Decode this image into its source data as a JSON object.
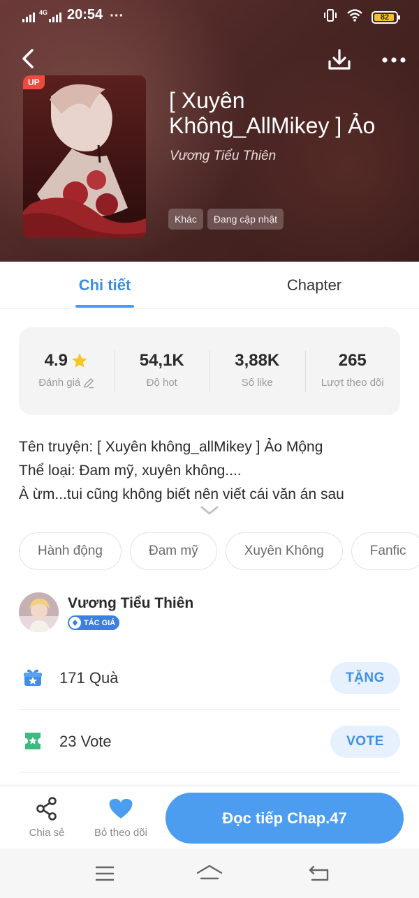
{
  "status_bar": {
    "network": "4G",
    "time": "20:54",
    "dots": "···",
    "battery": "82"
  },
  "book": {
    "badge": "UP",
    "title": "[ Xuyên Không_AllMikey ] Ảo",
    "author": "Vương Tiểu Thiên",
    "tags": [
      "Khác",
      "Đang cập nhật"
    ]
  },
  "tabs": [
    {
      "label": "Chi tiết",
      "active": true
    },
    {
      "label": "Chapter",
      "active": false
    }
  ],
  "stats": [
    {
      "value": "4.9",
      "label": "Đánh giá",
      "icon": "star-icon"
    },
    {
      "value": "54,1K",
      "label": "Độ hot"
    },
    {
      "value": "3,88K",
      "label": "Số like"
    },
    {
      "value": "265",
      "label": "Lượt theo dõi"
    }
  ],
  "description": {
    "lines": [
      "Tên truyện: [ Xuyên không_allMikey ] Ảo Mộng",
      "Thể loại: Đam mỹ, xuyên không....",
      "À ừm...tui cũng không biết nên viết cái văn án sau"
    ]
  },
  "genres": [
    "Hành động",
    "Đam mỹ",
    "Xuyên Không",
    "Fanfic"
  ],
  "author_section": {
    "name": "Vương Tiểu Thiên",
    "badge": "TÁC GIÁ"
  },
  "gift": {
    "count": "171",
    "label": "Quà",
    "button": "TẶNG",
    "icon": "gift-icon"
  },
  "vote": {
    "count": "23",
    "label": "Vote",
    "button": "VOTE",
    "icon": "ticket-icon"
  },
  "bottom_bar": {
    "share_label": "Chia sẻ",
    "follow_label": "Bỏ theo dõi",
    "read_button": "Đọc tiếp Chap.47"
  },
  "colors": {
    "accent": "#4c9cf0",
    "tab_active": "#3a8ee6",
    "gift_icon": "#3f8fe6",
    "vote_icon": "#3cba7f",
    "up_badge": "#ee4b3f",
    "battery": "#f2c12e"
  }
}
